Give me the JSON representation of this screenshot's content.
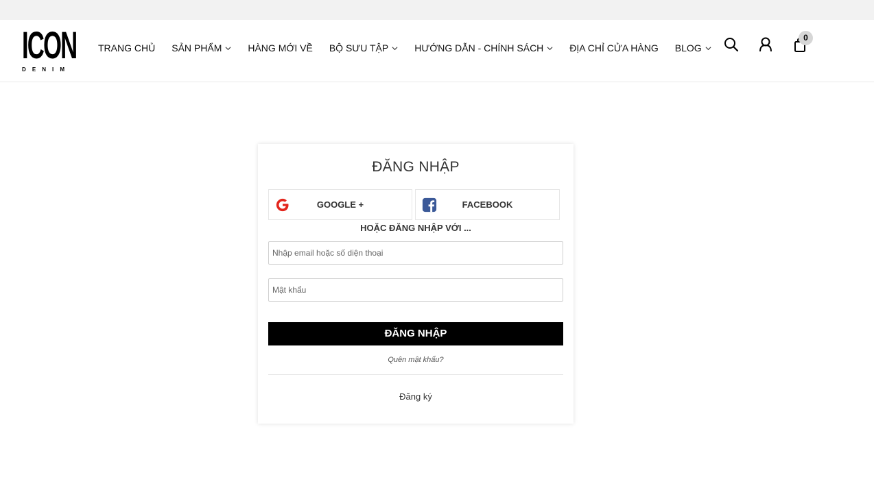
{
  "brand": {
    "logo_main": "ICON",
    "logo_sub": [
      "D",
      "E",
      "N",
      "I",
      "M"
    ]
  },
  "nav": {
    "items": [
      {
        "label": "TRANG CHỦ",
        "has_dropdown": false
      },
      {
        "label": "SẢN PHẨM",
        "has_dropdown": true
      },
      {
        "label": "HÀNG MỚI VỀ",
        "has_dropdown": false
      },
      {
        "label": "BỘ SƯU TẬP",
        "has_dropdown": true
      },
      {
        "label": "HƯỚNG DẪN - CHÍNH SÁCH",
        "has_dropdown": true
      },
      {
        "label": "ĐỊA CHỈ CỬA HÀNG",
        "has_dropdown": false
      },
      {
        "label": "BLOG",
        "has_dropdown": true
      }
    ]
  },
  "header_icons": {
    "search": "search-icon",
    "account": "user-icon",
    "cart": "cart-icon",
    "cart_count": "0"
  },
  "login": {
    "title": "ĐĂNG NHẬP",
    "google_label": "GOOGLE +",
    "facebook_label": "FACEBOOK",
    "or_text": "HOẶC ĐĂNG NHẬP VỚI ...",
    "email_placeholder": "Nhập email hoặc số diện thoại",
    "password_placeholder": "Mật khẩu",
    "submit_label": "ĐĂNG NHẬP",
    "forgot_label": "Quên mật khẩu?",
    "register_label": "Đăng ký"
  },
  "colors": {
    "google": "#e3261d",
    "facebook": "#3b5998",
    "button": "#000000",
    "topbar": "#f2f2f2"
  }
}
